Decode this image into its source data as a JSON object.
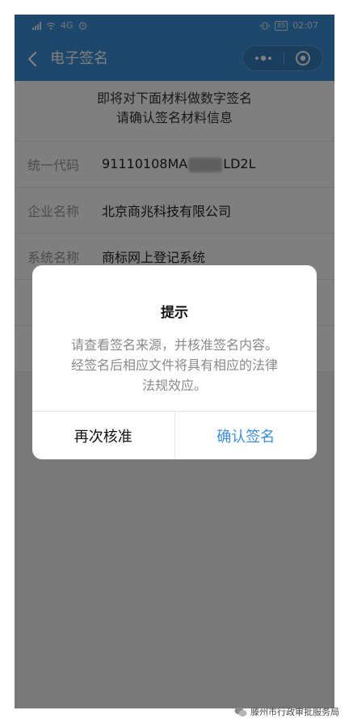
{
  "status_bar": {
    "network_type": "4G",
    "time": "02:07",
    "battery": "85"
  },
  "navbar": {
    "title": "电子签名"
  },
  "intro": {
    "line1": "即将对下面材料做数字签名",
    "line2": "请确认签名材料信息"
  },
  "fields": [
    {
      "label": "统一代码",
      "value_prefix": "91110108MA",
      "value_suffix": "LD2L"
    },
    {
      "label": "企业名称",
      "value": "北京商兆科技有限公司"
    },
    {
      "label": "系统名称",
      "value": "商标网上登记系统"
    }
  ],
  "dialog": {
    "title": "提示",
    "message_lines": [
      "请查看签名来源，并核准签名内容。",
      "经签名后相应文件将具有相应的法律",
      "法规效应。"
    ],
    "cancel_label": "再次核准",
    "confirm_label": "确认签名",
    "accent_color": "#3a8ed6"
  },
  "watermark": {
    "text": "滕州市行政审批服务局"
  }
}
